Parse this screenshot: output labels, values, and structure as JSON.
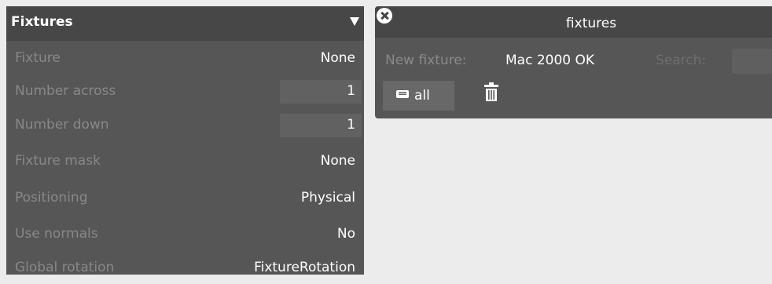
{
  "properties_panel": {
    "title": "Fixtures",
    "collapse_icon": "triangle-down-icon",
    "rows": [
      {
        "label": "Fixture",
        "value": "None"
      },
      {
        "label": "Number across",
        "value": "1"
      },
      {
        "label": "Number down",
        "value": "1"
      },
      {
        "label": "Fixture mask",
        "value": "None"
      },
      {
        "label": "Positioning",
        "value": "Physical"
      },
      {
        "label": "Use normals",
        "value": "No"
      },
      {
        "label": "Global rotation",
        "value": "FixtureRotation"
      }
    ]
  },
  "fixtures_window": {
    "title": "fixtures",
    "close_icon": "close-icon",
    "new_fixture_label": "New fixture:",
    "new_fixture_value": "Mac 2000 OK",
    "search_label": "Search:",
    "search_value": "",
    "all_button_label": "all",
    "all_button_icon": "list-icon",
    "delete_icon": "trash-icon"
  }
}
